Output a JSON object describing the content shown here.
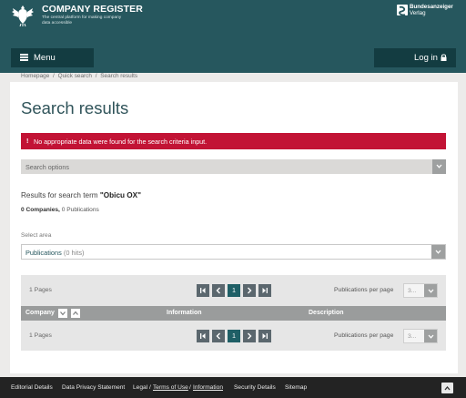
{
  "header": {
    "title": "COMPANY REGISTER",
    "tagline": "The central platform for making company data accessible",
    "publisher_line1": "Bundesanzeiger",
    "publisher_line2": "Verlag",
    "menu_label": "Menu",
    "login_label": "Log in"
  },
  "breadcrumb": {
    "home": "Homepage",
    "quick": "Quick search",
    "current": "Search results",
    "separator": "/"
  },
  "main": {
    "title": "Search results",
    "error_mark": "!",
    "error_message": "No appropriate data were found for the search criteria input.",
    "search_options": "Search options",
    "results_prefix": "Results for search term",
    "search_term": "\"Obicu OX\"",
    "companies_count": "0",
    "companies_label": "Companies,",
    "publications_count": "0",
    "publications_label": "Publications",
    "select_area_label": "Select area",
    "area_selected": "Publications",
    "area_hits": "(0 hits)"
  },
  "pagination": {
    "pages_text": "1 Pages",
    "current_page": "1",
    "per_page_label": "Publications per page",
    "per_page_value": "3..."
  },
  "table": {
    "headers": [
      "Company",
      "Information",
      "Description"
    ]
  },
  "footer": {
    "editorial": "Editorial Details",
    "privacy": "Data Privacy Statement",
    "legal": "Legal",
    "terms": "Terms of Use",
    "information": "Information",
    "security": "Security Details",
    "sitemap": "Sitemap",
    "separator": "/"
  },
  "colors": {
    "header_bg": "#26575e",
    "button_dark": "#133c41",
    "error_red": "#c21335",
    "title_teal": "#30545a",
    "footer_bg": "#232323"
  },
  "icons": [
    "eagle-logo-icon",
    "bundesanzeiger-logo-icon",
    "hamburger-icon",
    "lock-icon",
    "chevron-down-icon",
    "first-page-icon",
    "prev-page-icon",
    "next-page-icon",
    "last-page-icon",
    "sort-down-icon",
    "sort-up-icon",
    "chevron-up-icon"
  ]
}
